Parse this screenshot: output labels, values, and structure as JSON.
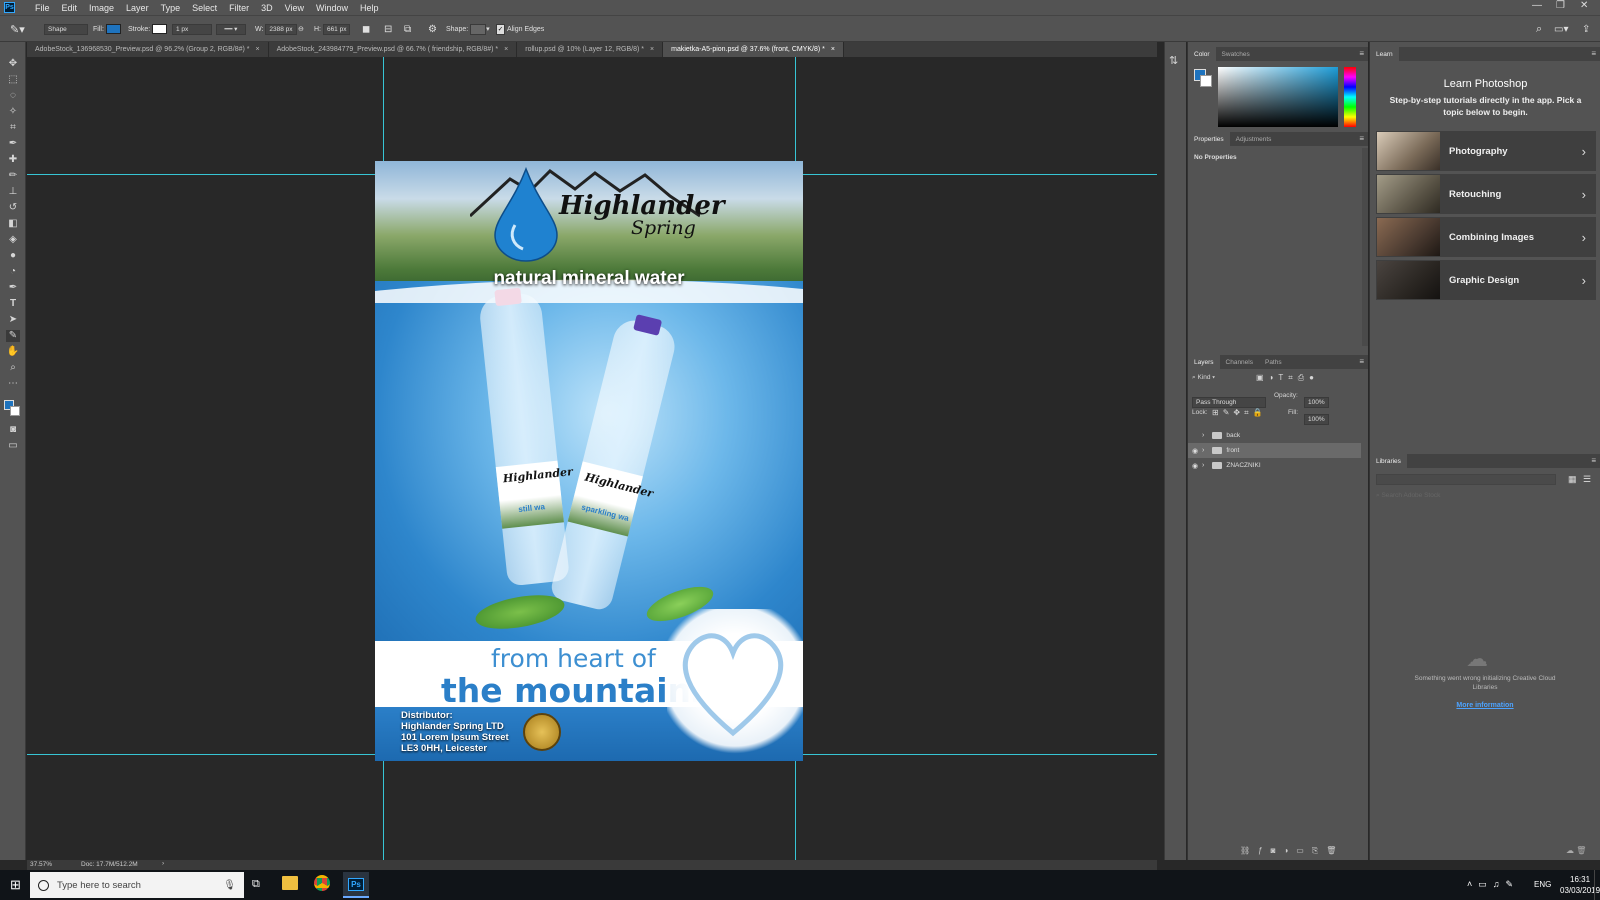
{
  "app": {
    "logo": "Ps"
  },
  "menu": [
    "File",
    "Edit",
    "Image",
    "Layer",
    "Type",
    "Select",
    "Filter",
    "3D",
    "View",
    "Window",
    "Help"
  ],
  "window_controls": {
    "minimize": "—",
    "restore": "❐",
    "close": "✕"
  },
  "options": {
    "mode": "Shape",
    "fill_label": "Fill:",
    "stroke_label": "Stroke:",
    "stroke_width": "1 px",
    "w_label": "W:",
    "w_value": "2388 px",
    "link": "⊖",
    "h_label": "H:",
    "h_value": "661 px",
    "shape_label": "Shape:",
    "align_edges": "Align Edges"
  },
  "tabs": [
    {
      "label": "AdobeStock_136968530_Preview.psd @ 96.2% (Group 2, RGB/8#) *"
    },
    {
      "label": "AdobeStock_243984779_Preview.psd @ 66.7% ( friendship, RGB/8#) *"
    },
    {
      "label": "rollup.psd @ 10% (Layer 12, RGB/8) *"
    },
    {
      "label": "makietka-A5-pion.psd @ 37.6% (front, CMYK/8) *"
    }
  ],
  "poster": {
    "brand_main": "Highlander",
    "brand_sub": "Spring",
    "headline": "natural mineral water",
    "bottle1_brand": "Highlander",
    "bottle1_type": "still wa",
    "bottle2_brand": "Highlander",
    "bottle2_type": "sparkling wa",
    "tagline1": "from heart of",
    "tagline2": "the mountains",
    "distributor": [
      "Distributor:",
      "Highlander Spring LTD",
      "101 Lorem Ipsum Street",
      "LE3 0HH, Leicester"
    ]
  },
  "color_panel": {
    "tab_color": "Color",
    "tab_swatches": "Swatches",
    "fg": "#1e73be",
    "bg": "#ffffff"
  },
  "properties_panel": {
    "tab_properties": "Properties",
    "tab_adjustments": "Adjustments",
    "body": "No Properties"
  },
  "layers_panel": {
    "tab_layers": "Layers",
    "tab_channels": "Channels",
    "tab_paths": "Paths",
    "kind": "Kind",
    "blend_mode": "Pass Through",
    "opacity_label": "Opacity:",
    "opacity": "100%",
    "lock_label": "Lock:",
    "fill_label": "Fill:",
    "fill": "100%",
    "layers": [
      {
        "name": "back",
        "visible": false,
        "selected": false
      },
      {
        "name": "front",
        "visible": true,
        "selected": true
      },
      {
        "name": "ZNACZNIKI",
        "visible": true,
        "selected": false
      }
    ]
  },
  "learn_panel": {
    "tab": "Learn",
    "heading": "Learn Photoshop",
    "subtitle": "Step-by-step tutorials directly in the app. Pick a topic below to begin.",
    "items": [
      {
        "label": "Photography",
        "thumb": "#8a7a68"
      },
      {
        "label": "Retouching",
        "thumb": "#5c5648"
      },
      {
        "label": "Combining Images",
        "thumb": "#4a3a30"
      },
      {
        "label": "Graphic Design",
        "thumb": "#2a2622"
      }
    ]
  },
  "libraries_panel": {
    "tab": "Libraries",
    "search_placeholder": "Search Adobe Stock",
    "error": "Something went wrong initializing Creative Cloud Libraries",
    "more_info": "More information"
  },
  "status": {
    "zoom": "37.57%",
    "doc": "Doc: 17.7M/512.2M"
  },
  "taskbar": {
    "search_placeholder": "Type here to search",
    "lang": "ENG",
    "time": "16:31",
    "date": "03/03/2019"
  }
}
